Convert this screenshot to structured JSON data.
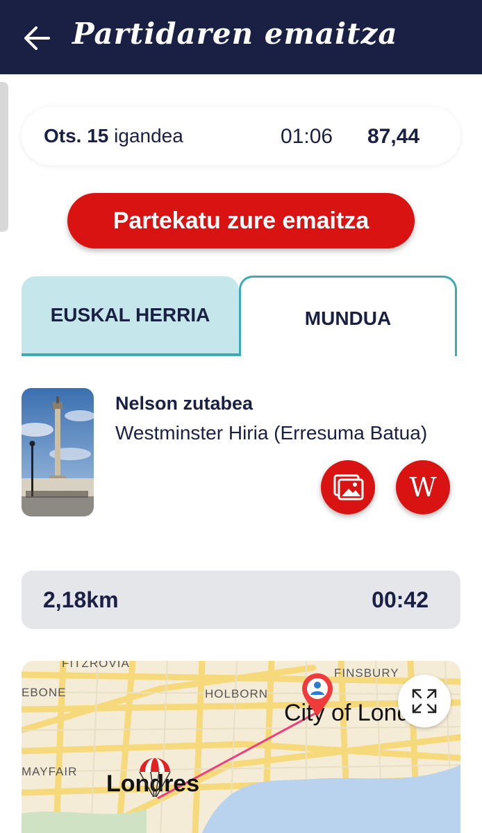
{
  "header": {
    "title": "Partidaren emaitza",
    "back_icon": "arrow-left-icon"
  },
  "summary": {
    "date_bold": "Ots. 15",
    "date_rest": " igandea",
    "time": "01:06",
    "score": "87,44"
  },
  "share": {
    "label": "Partekatu zure emaitza"
  },
  "tabs": [
    {
      "label": "EUSKAL HERRIA",
      "selected": false
    },
    {
      "label": "MUNDUA",
      "selected": true
    }
  ],
  "place": {
    "name": "Nelson zutabea",
    "location": "Westminster Hiria (Erresuma Batua)",
    "gallery_icon": "gallery-icon",
    "wiki_icon": "wikipedia-icon",
    "wiki_glyph": "W"
  },
  "stats": {
    "distance": "2,18km",
    "duration": "00:42"
  },
  "map": {
    "labels": {
      "fitzrovia": "FITZROVIA",
      "bone": "EBONE",
      "holborn": "HOLBORN",
      "finsbury": "FINSBURY",
      "mayfair": "MAYFAIR",
      "city": "City of Lond",
      "london": "Londres"
    },
    "expand_icon": "expand-icon"
  },
  "colors": {
    "navy": "#1a1f44",
    "red": "#d91212",
    "teal": "#3aaab4",
    "tab_bg": "#c5e6ea"
  }
}
